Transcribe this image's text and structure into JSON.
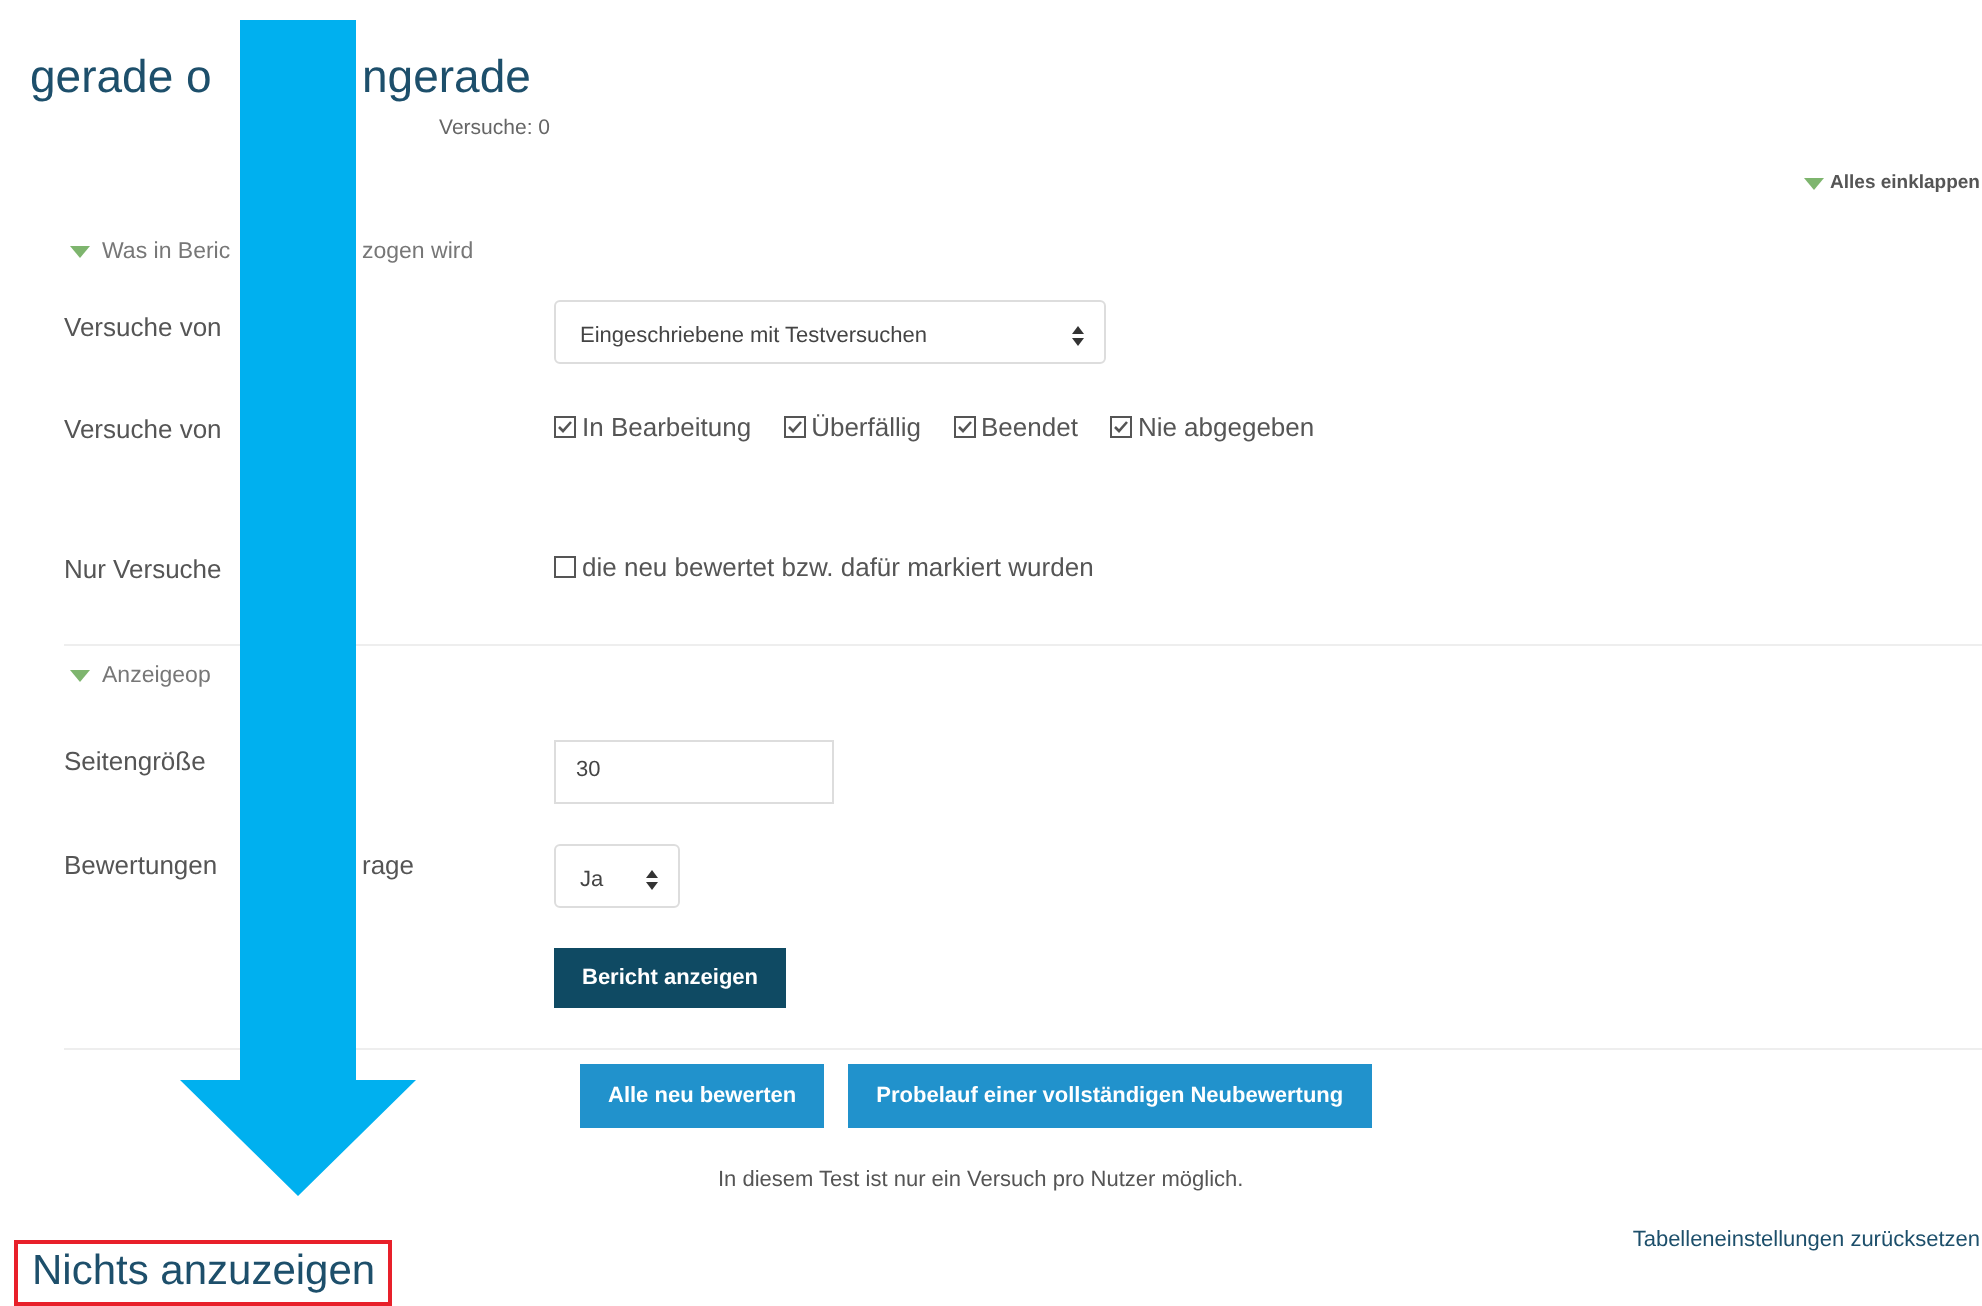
{
  "page": {
    "title_parts": [
      "gerade o",
      "ngerade"
    ],
    "attempts": "Versuche: 0",
    "collapse_all": "Alles einklappen"
  },
  "sections": [
    {
      "title_parts": [
        "Was in Beric",
        "zogen wird"
      ],
      "expanded": true,
      "rows": [
        {
          "kind": "select",
          "label_parts": [
            "Versuche von"
          ],
          "value": "Eingeschriebene mit Testversuchen"
        },
        {
          "kind": "checkboxes",
          "label_parts": [
            "Versuche von"
          ],
          "options": [
            {
              "label": "In Bearbeitung",
              "checked": true
            },
            {
              "label": "Überfällig",
              "checked": true
            },
            {
              "label": "Beendet",
              "checked": true
            },
            {
              "label": "Nie abgegeben",
              "checked": true
            }
          ]
        },
        {
          "kind": "checkboxes",
          "label_parts": [
            "Nur Versuche"
          ],
          "options": [
            {
              "label": "die neu bewertet bzw. dafür markiert wurden",
              "checked": false
            }
          ]
        }
      ]
    },
    {
      "title_parts": [
        "Anzeigeop"
      ],
      "expanded": true,
      "rows": [
        {
          "kind": "input",
          "label_parts": [
            "Seitengröße"
          ],
          "value": "30"
        },
        {
          "kind": "select",
          "label_parts": [
            "Bewertungen",
            "rage"
          ],
          "value": "Ja"
        }
      ]
    }
  ],
  "submit": "Bericht anzeigen",
  "actions": [
    "Alle neu bewerten",
    "Probelauf einer vollständigen Neubewertung"
  ],
  "note": "In diesem Test ist nur ein Versuch pro Nutzer möglich.",
  "reset_link": "Tabelleneinstellungen zurücksetzen",
  "result": "Nichts anzuzeigen"
}
